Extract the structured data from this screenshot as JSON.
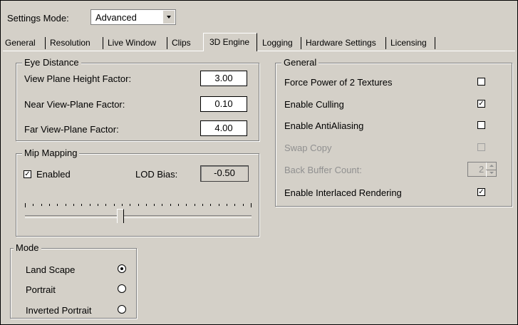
{
  "settings_mode": {
    "label": "Settings Mode:",
    "value": "Advanced"
  },
  "tabs": [
    {
      "label": "General"
    },
    {
      "label": "Resolution"
    },
    {
      "label": "Live Window"
    },
    {
      "label": "Clips"
    },
    {
      "label": "3D Engine",
      "active": true
    },
    {
      "label": "Logging"
    },
    {
      "label": "Hardware Settings"
    },
    {
      "label": "Licensing"
    }
  ],
  "eye_distance": {
    "title": "Eye Distance",
    "rows": [
      {
        "label": "View Plane Height Factor:",
        "value": "3.00"
      },
      {
        "label": "Near View-Plane Factor:",
        "value": "0.10"
      },
      {
        "label": "Far View-Plane Factor:",
        "value": "4.00"
      }
    ]
  },
  "mip_mapping": {
    "title": "Mip Mapping",
    "enabled_label": "Enabled",
    "enabled": true,
    "lod_label": "LOD Bias:",
    "lod_value": "-0.50",
    "slider_level": 0.42
  },
  "mode": {
    "title": "Mode",
    "options": [
      {
        "label": "Land Scape",
        "selected": true
      },
      {
        "label": "Portrait",
        "selected": false
      },
      {
        "label": "Inverted Portrait",
        "selected": false
      }
    ]
  },
  "general": {
    "title": "General",
    "rows": [
      {
        "label": "Force Power of 2 Textures",
        "checked": false,
        "disabled": false
      },
      {
        "label": "Enable Culling",
        "checked": true,
        "disabled": false
      },
      {
        "label": "Enable AntiAliasing",
        "checked": false,
        "disabled": false
      },
      {
        "label": "Swap Copy",
        "checked": false,
        "disabled": true
      },
      {
        "label": "Back Buffer Count:",
        "spinner": "2",
        "disabled": true
      },
      {
        "label": "Enable Interlaced Rendering",
        "checked": true,
        "disabled": false
      }
    ]
  }
}
